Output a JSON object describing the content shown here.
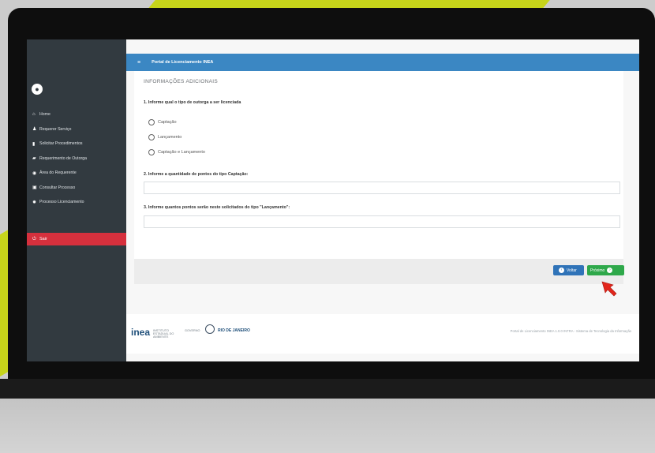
{
  "header": {
    "title": "Portal de Licenciamento INEA"
  },
  "sidebar": {
    "items": [
      {
        "icon": "home-icon",
        "label": "Home"
      },
      {
        "icon": "user-icon",
        "label": "Requerer Serviço"
      },
      {
        "icon": "file-icon",
        "label": "Solicitar Procedimentos"
      },
      {
        "icon": "folder-icon",
        "label": "Requerimento de Outorga"
      },
      {
        "icon": "eye-icon",
        "label": "Área do Requerente"
      },
      {
        "icon": "check-icon",
        "label": "Consultar Processo"
      },
      {
        "icon": "gear-icon",
        "label": "Processo Licenciamento"
      }
    ],
    "logout": "Sair"
  },
  "form": {
    "section_title": "INFORMAÇÕES ADICIONAIS",
    "q1": "1. Informe qual o tipo de outorga a ser licenciada",
    "options": [
      "Captação",
      "Lançamento",
      "Captação e Lançamento"
    ],
    "q2": "2. Informe a quantidade de pontos do tipo Captação:",
    "q2_value": "",
    "q3": "3. Informe quantos pontos serão neste solicitados do tipo \"Lançamento\":",
    "q3_value": "",
    "back_label": "Voltar",
    "next_label": "Próximo"
  },
  "footer": {
    "logo": "inea",
    "logo_sub": "INSTITUTO ESTADUAL DO AMBIENTE",
    "gov": "GOVERNO",
    "state": "RIO DE JANEIRO",
    "right": "Portal de Licenciamento INEA 1.0.0 INTRA - Sistema de Tecnologia da Informação"
  },
  "colors": {
    "header": "#3b87c3",
    "sidebar": "#323a40",
    "logout": "#d6303d",
    "back_button": "#2f73b8",
    "next_button": "#2ea84a",
    "accent": "#c6d41a"
  }
}
